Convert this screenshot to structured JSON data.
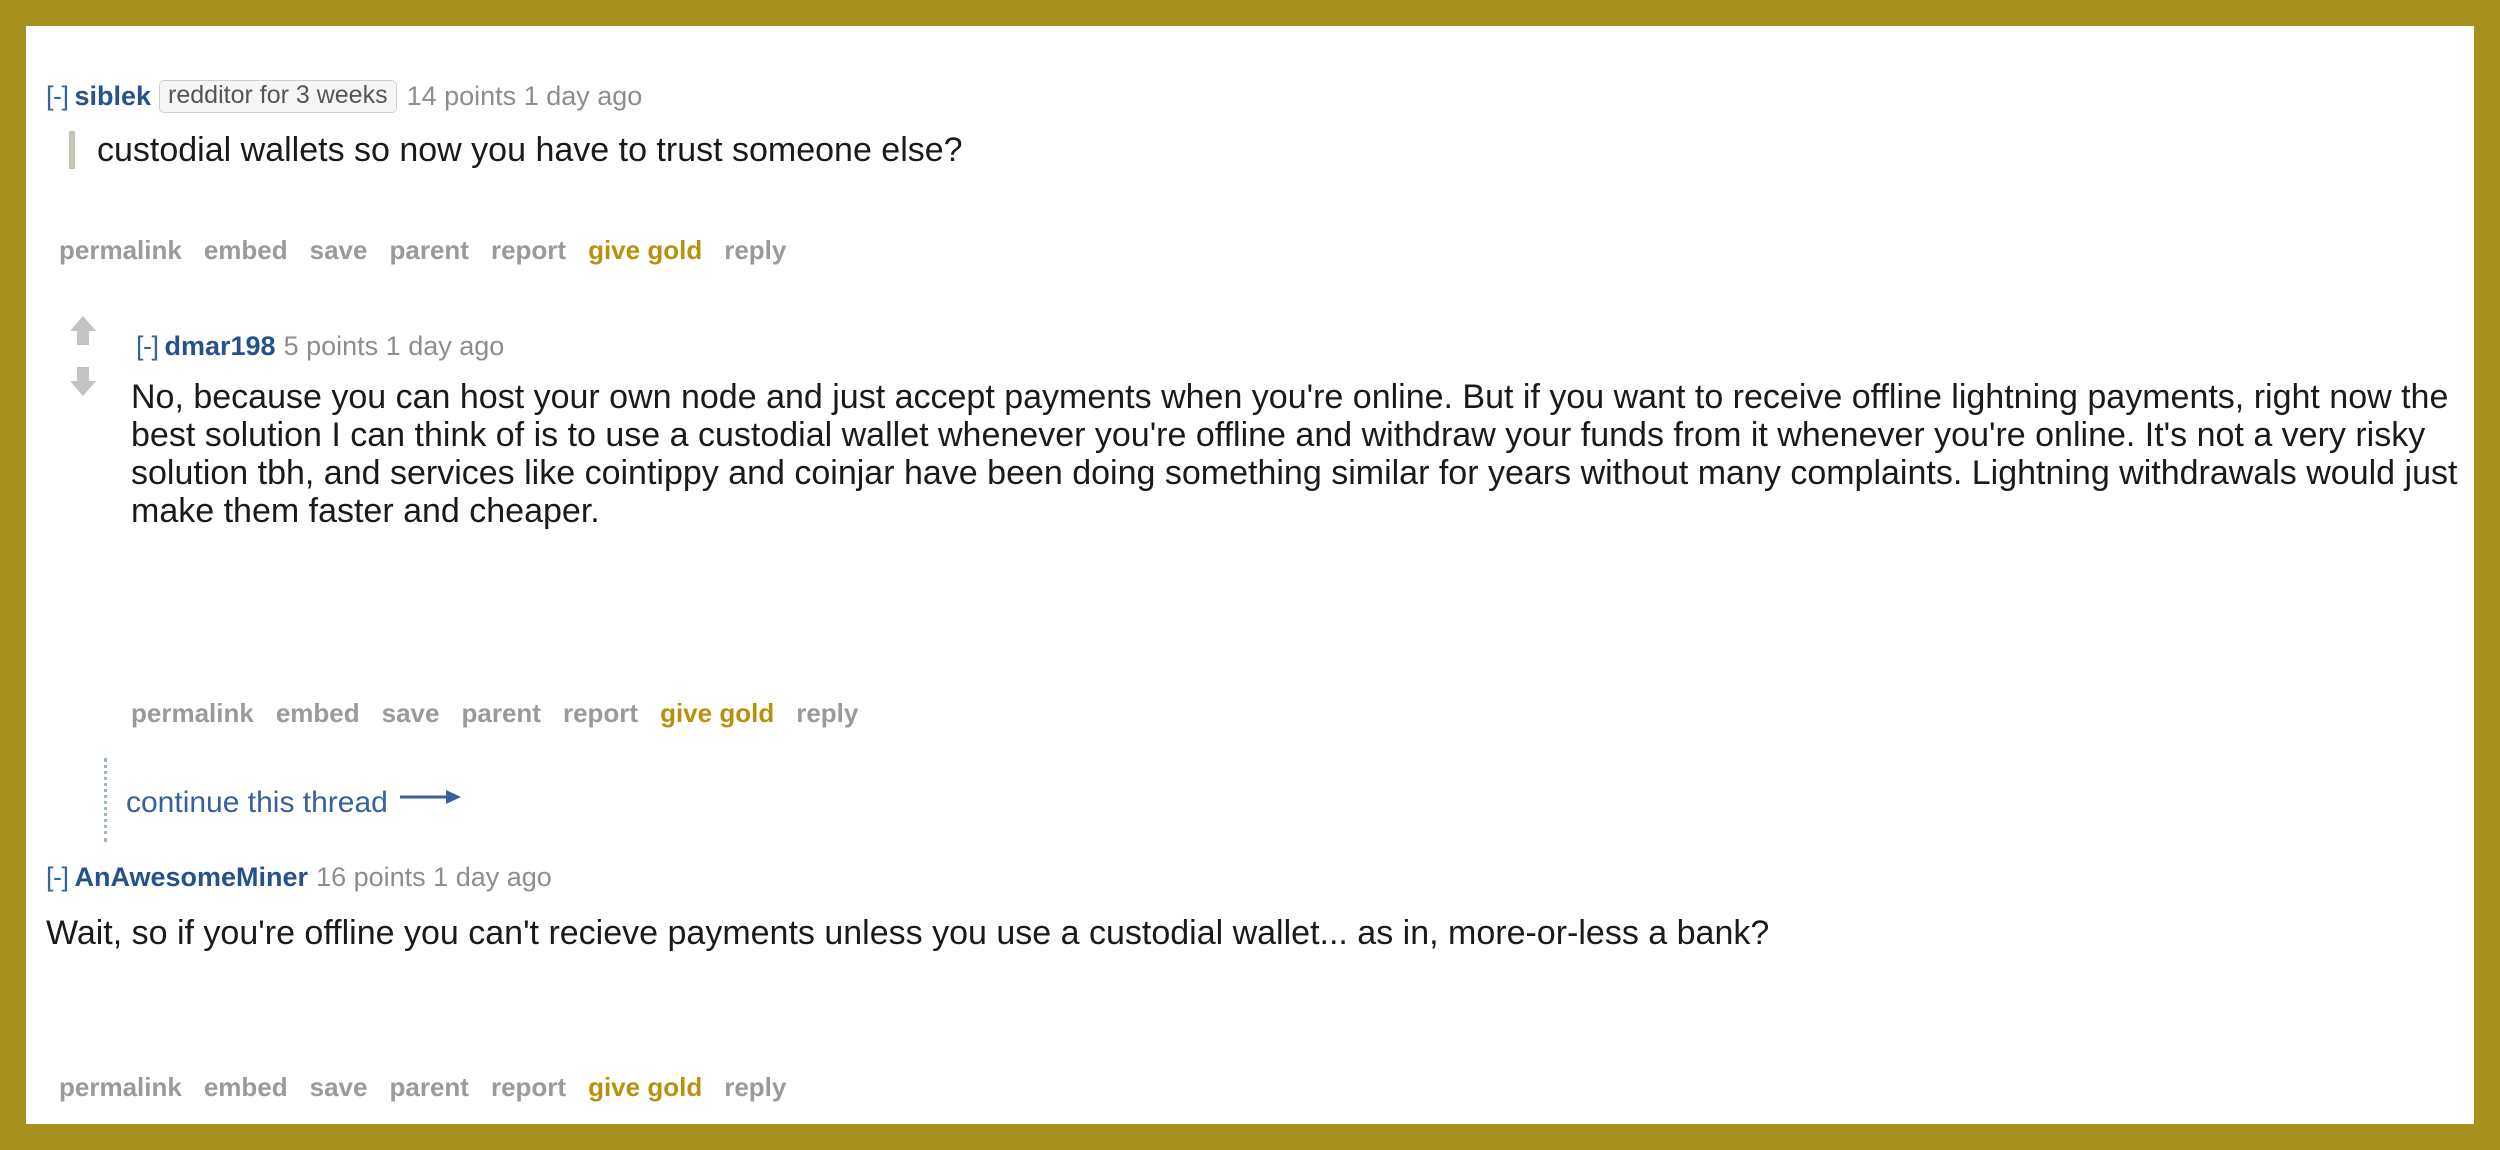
{
  "page": {
    "site": "reddit comment thread",
    "frame_color": "#a8901f",
    "background_color": "#ffffff",
    "link_color": "#36609e",
    "author_color": "#26528c",
    "meta_color": "#8d8d8d",
    "action_color": "#9a9a9a",
    "gold_link_color": "#b8920f"
  },
  "actions": {
    "permalink": "permalink",
    "embed": "embed",
    "save": "save",
    "parent": "parent",
    "report": "report",
    "give_gold": "give gold",
    "reply": "reply"
  },
  "comments": [
    {
      "id": "comment-siblek",
      "collapse": "[-]",
      "author": "siblek",
      "badge": "redditor for 3 weeks",
      "score": "14 points",
      "when": "1 day ago",
      "body": "custodial wallets so now you have to trust someone else?",
      "quoted": true,
      "has_votes": false
    },
    {
      "id": "comment-dmar198",
      "collapse": "[-]",
      "author": "dmar198",
      "badge": "",
      "score": "5 points",
      "when": "1 day ago",
      "body": "No, because you can host your own node and just accept payments when you're online. But if you want to receive offline lightning payments, right now the best solution I can think of is to use a custodial wallet whenever you're offline and withdraw your funds from it whenever you're online. It's not a very risky solution tbh, and services like cointippy and coinjar have been doing something similar for years without many complaints. Lightning withdrawals would just make them faster and cheaper.",
      "quoted": false,
      "has_votes": true
    },
    {
      "id": "comment-anawesomeminer",
      "collapse": "[-]",
      "author": "AnAwesomeMiner",
      "badge": "",
      "score": "16 points",
      "when": "1 day ago",
      "body": "Wait, so if you're offline you can't recieve payments unless you use a custodial wallet... as in, more-or-less a bank?",
      "quoted": false,
      "has_votes": false
    }
  ],
  "continue_thread": {
    "label": "continue this thread",
    "arrow_icon": "long-right-arrow"
  }
}
